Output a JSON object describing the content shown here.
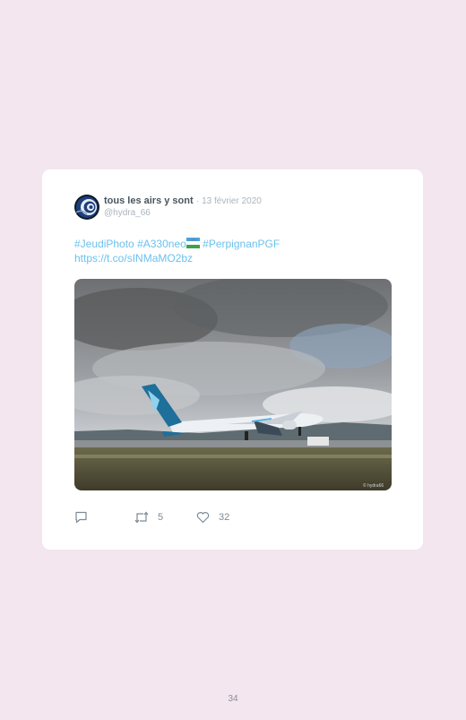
{
  "tweet": {
    "author_name": "tous les airs y sont",
    "separator": "·",
    "date": "13 février 2020",
    "handle": "@hydra_66",
    "hashtag_1": "#JeudiPhoto",
    "hashtag_2": "#A330neo",
    "flag_icon": "flag-emoji",
    "hashtag_3": "#PerpignanPGF",
    "link": "https://t.co/sINMaMO2bz",
    "photo_alt": "Airbus A330neo on a runway under a cloudy sky",
    "photo_watermark": "© hydra66"
  },
  "actions": {
    "reply_icon": "reply-icon",
    "retweet_icon": "retweet-icon",
    "retweet_count": "5",
    "like_icon": "heart-icon",
    "like_count": "32"
  },
  "page": {
    "number": "34"
  },
  "colors": {
    "background": "#f3e6ee",
    "card": "#ffffff",
    "link": "#6cc1ec",
    "muted": "#aab4bd"
  }
}
